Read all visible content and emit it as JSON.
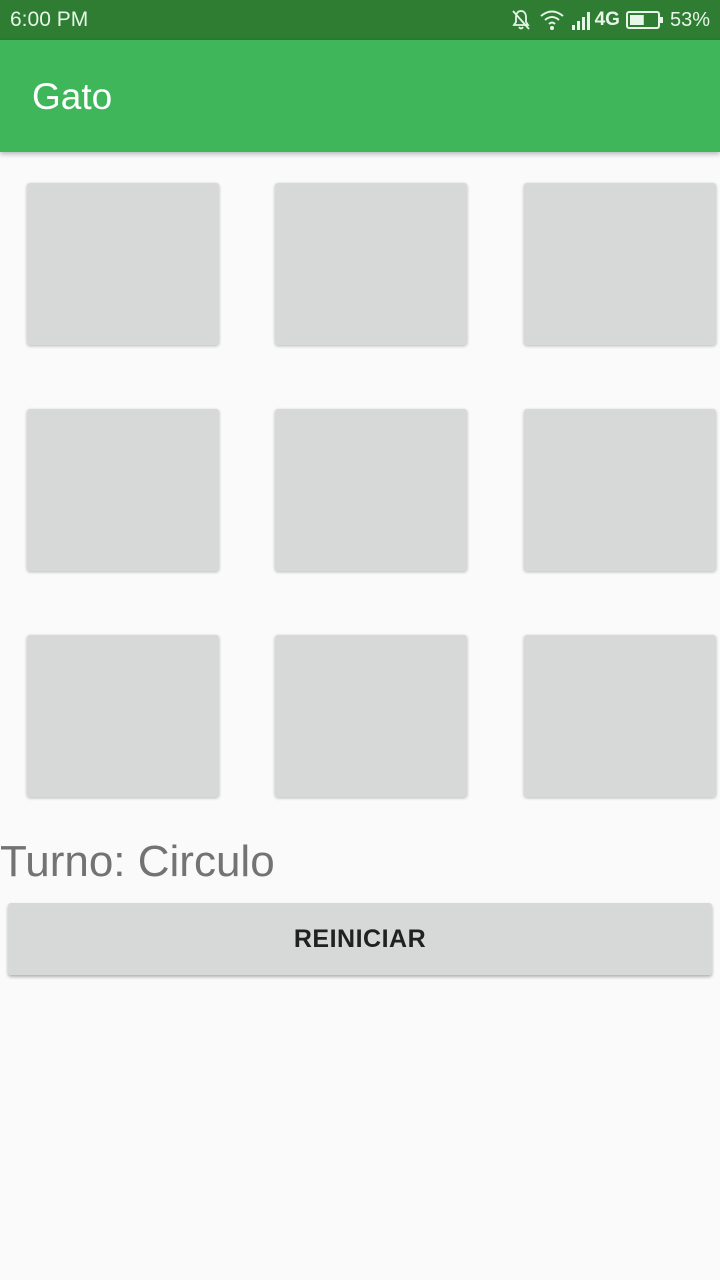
{
  "status_bar": {
    "time": "6:00 PM",
    "network_label": "4G",
    "battery_percent": "53%",
    "battery_level": 0.53,
    "icons": [
      "bell-muted-icon",
      "wifi-icon",
      "signal-icon",
      "battery-icon"
    ]
  },
  "app_bar": {
    "title": "Gato",
    "color": "#40b65a"
  },
  "board": {
    "rows": 3,
    "columns": 3,
    "cells": [
      "",
      "",
      "",
      "",
      "",
      "",
      "",
      "",
      ""
    ]
  },
  "turn": {
    "text": "Turno: Circulo"
  },
  "reset_button": {
    "label": "REINICIAR"
  },
  "colors": {
    "status_bar": "#2e7d32",
    "primary": "#40b65a",
    "cell": "#d7d8d8",
    "background": "#fafafa"
  }
}
